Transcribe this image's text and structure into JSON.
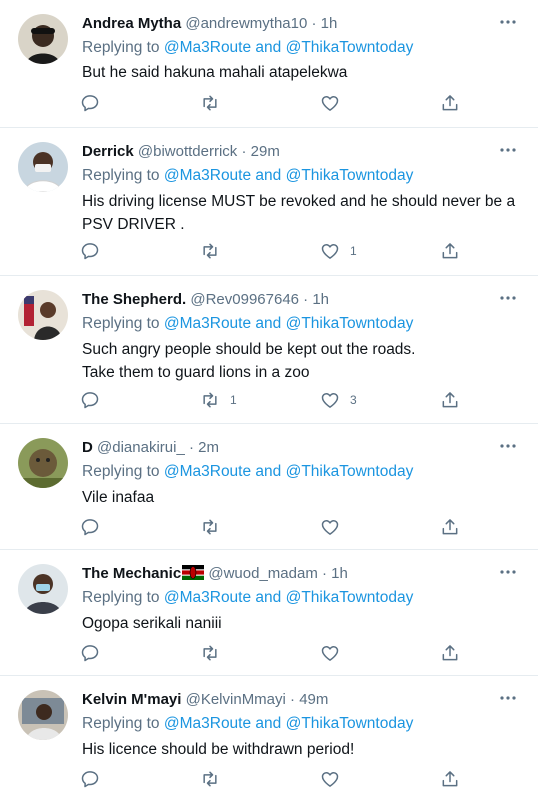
{
  "reply_prefix": "Replying to",
  "reply_mentions": "@Ma3Route and @ThikaTowntoday",
  "colors": {
    "link": "#1b95e0",
    "muted": "#5b7083",
    "text": "#0f1419",
    "divider": "#e6ecf0"
  },
  "tweets": [
    {
      "name": "Andrea Mytha",
      "handle": "@andrewmytha10",
      "sep": " · ",
      "time": "1h",
      "text": "But he said hakuna mahali atapelekwa",
      "retweets": "",
      "likes": ""
    },
    {
      "name": "Derrick",
      "handle": "@biwottderrick",
      "sep": " · ",
      "time": "29m",
      "text": "His driving license MUST be revoked and he should never be a PSV DRIVER .",
      "retweets": "",
      "likes": "1"
    },
    {
      "name": "The Shepherd.",
      "handle": "@Rev09967646",
      "sep": " · ",
      "time": "1h",
      "text": "Such angry people should be kept out the roads.\nTake them to guard lions in a zoo",
      "retweets": "1",
      "likes": "3"
    },
    {
      "name": "D",
      "handle": "@dianakirui_",
      "sep": " · ",
      "time": "2m",
      "text": "Vile inafaa",
      "retweets": "",
      "likes": ""
    },
    {
      "name": "The Mechanic",
      "handle": "@wuod_madam",
      "sep": " · ",
      "time": "1h",
      "text": "Ogopa serikali naniii",
      "retweets": "",
      "likes": "",
      "flag_icon": "kenya-flag-icon"
    },
    {
      "name": "Kelvin M'mayi",
      "handle": "@KelvinMmayi",
      "sep": " · ",
      "time": "49m",
      "text": "His licence should be withdrawn period!",
      "retweets": "",
      "likes": ""
    }
  ],
  "icons": [
    "reply-icon",
    "retweet-icon",
    "like-icon",
    "share-icon",
    "more-icon"
  ]
}
